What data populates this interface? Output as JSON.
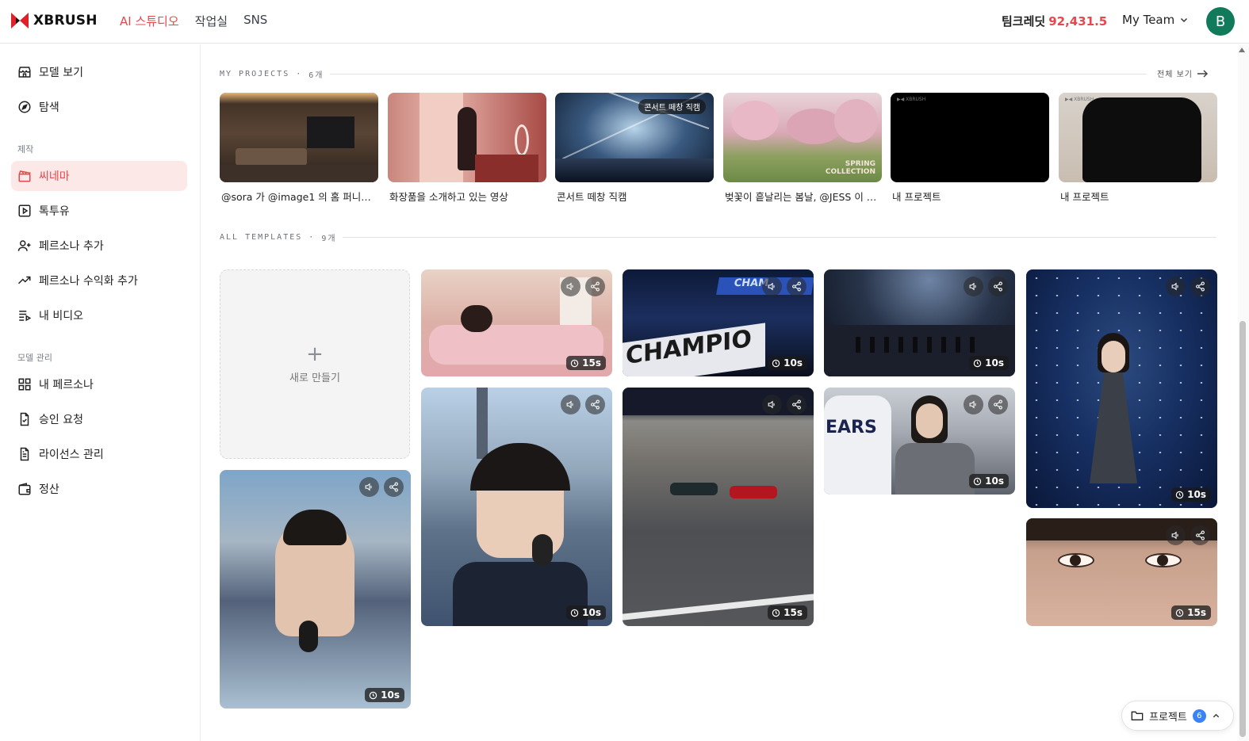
{
  "app": {
    "name": "XBRUSH"
  },
  "nav": [
    {
      "label": "AI 스튜디오",
      "active": true
    },
    {
      "label": "작업실",
      "active": false
    },
    {
      "label": "SNS",
      "active": false
    }
  ],
  "credit": {
    "label": "팀크레딧",
    "amount": "92,431.5"
  },
  "team": {
    "label": "My Team"
  },
  "user": {
    "initial": "B"
  },
  "sidebar": {
    "top_items": [
      {
        "label": "모델 보기",
        "icon": "store-icon"
      },
      {
        "label": "탐색",
        "icon": "compass-icon"
      }
    ],
    "section_create": "제작",
    "create_items": [
      {
        "label": "씨네마",
        "icon": "clapperboard-icon",
        "active": true
      },
      {
        "label": "톡투유",
        "icon": "play-square-icon"
      },
      {
        "label": "페르소나 추가",
        "icon": "user-plus-icon"
      },
      {
        "label": "페르소나 수익화 추가",
        "icon": "trending-up-icon"
      },
      {
        "label": "내 비디오",
        "icon": "list-video-icon"
      }
    ],
    "section_manage": "모델 관리",
    "manage_items": [
      {
        "label": "내 페르소나",
        "icon": "grid-icon"
      },
      {
        "label": "승인 요청",
        "icon": "file-check-icon"
      },
      {
        "label": "라이선스 관리",
        "icon": "file-text-icon"
      },
      {
        "label": "정산",
        "icon": "wallet-icon"
      }
    ]
  },
  "projects": {
    "heading": "MY PROJECTS",
    "count": "6개",
    "view_all": "전체 보기",
    "items": [
      {
        "title": "@sora 가 @image1 의 홈 퍼니처...",
        "tag": ""
      },
      {
        "title": "화장품을 소개하고 있는 영상",
        "tag": ""
      },
      {
        "title": "콘서트 떼창 직캠",
        "tag": "콘서트 떼창 직캠"
      },
      {
        "title": "벚꽃이 흩날리는 봄날, @JESS 이 한...",
        "tag": ""
      },
      {
        "title": "내 프로젝트",
        "tag": ""
      },
      {
        "title": "내 프로젝트",
        "tag": ""
      }
    ]
  },
  "templates": {
    "heading": "ALL TEMPLATES",
    "count": "9개",
    "new_label": "새로 만들기",
    "items": [
      {
        "duration": "15s"
      },
      {
        "duration": "10s"
      },
      {
        "duration": "10s"
      },
      {
        "duration": "10s"
      },
      {
        "duration": "10s"
      },
      {
        "duration": "15s"
      },
      {
        "duration": "10s"
      },
      {
        "duration": "10s"
      },
      {
        "duration": "15s"
      }
    ]
  },
  "float_panel": {
    "label": "프로젝트",
    "count": "6"
  },
  "colors": {
    "accent": "#e5484d",
    "avatar": "#117a5a",
    "badge": "#3b82f6"
  }
}
